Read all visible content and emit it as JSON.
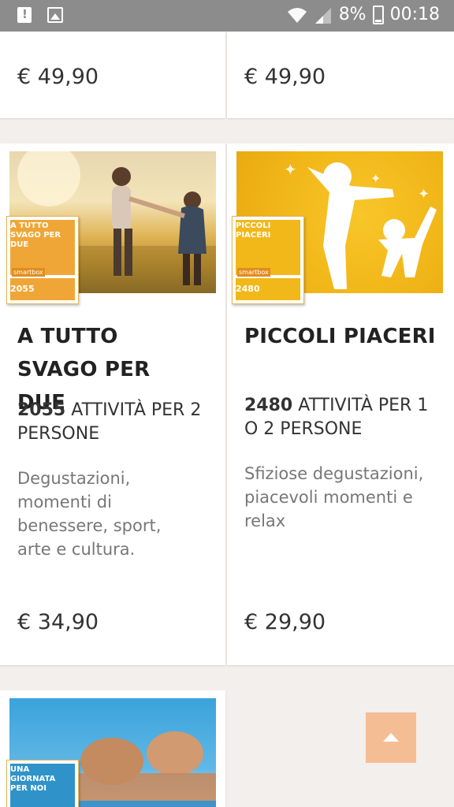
{
  "status_bar": {
    "battery": "8%",
    "time": "00:18",
    "icons": [
      "alert-icon",
      "image-icon",
      "wifi-icon",
      "signal-icon",
      "battery-icon"
    ]
  },
  "top_row": [
    {
      "price": "€ 49,90"
    },
    {
      "price": "€ 49,90"
    }
  ],
  "products": [
    {
      "box_label": "A TUTTO SVAGO PER DUE",
      "box_count": "2055",
      "title": "A TUTTO SVAGO PER DUE",
      "count_num": "2055",
      "count_text": "ATTIVITÀ PER 2 PERSONE",
      "description": "Degustazioni, momenti di benessere, sport, arte e cultura.",
      "price": "€ 34,90"
    },
    {
      "box_label": "PICCOLI PIACERI",
      "box_count": "2480",
      "title": "PICCOLI PIACERI",
      "count_num": "2480",
      "count_text": "ATTIVITÀ PER 1 O 2 PERSONE",
      "description": "Sfiziose degustazioni, piacevoli momenti e relax",
      "price": "€ 29,90"
    },
    {
      "box_label": "UNA GIORNATA PER NOI"
    }
  ],
  "box_brand": "smartbox",
  "colors": {
    "status_bar": "#8c8c8c",
    "accent_orange": "#f0a637",
    "scroll_button": "#f5bd94",
    "background": "#f3efec"
  }
}
